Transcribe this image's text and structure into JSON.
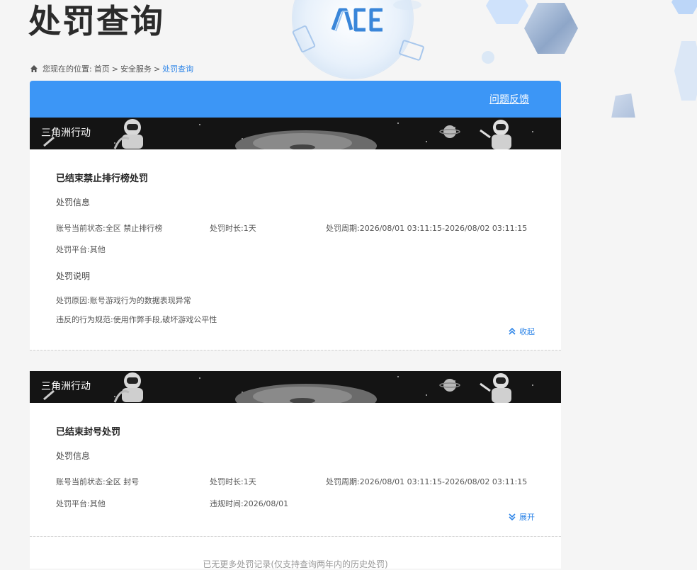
{
  "page": {
    "title": "处罚查询"
  },
  "breadcrumb": {
    "prefix": "您现在的位置:",
    "home": "首页",
    "sep1": ">",
    "security": "安全服务",
    "sep2": ">",
    "current": "处罚查询"
  },
  "header": {
    "feedback": "问题反馈"
  },
  "records": [
    {
      "game": "三角洲行动",
      "title": "已结束禁止排行榜处罚",
      "info_title": "处罚信息",
      "status_label": "账号当前状态:",
      "status_value": "全区 禁止排行榜",
      "duration_label": "处罚时长:",
      "duration_value": "1天",
      "period_label": "处罚周期:",
      "period_value": "2026/08/01 03:11:15-2026/08/02 03:11:15",
      "platform_label": "处罚平台:",
      "platform_value": "其他",
      "desc_title": "处罚说明",
      "reason_label": "处罚原因:",
      "reason_value": "账号游戏行为的数据表现异常",
      "rule_label": "违反的行为规范:",
      "rule_value": "使用作弊手段,破坏游戏公平性",
      "toggle": "收起"
    },
    {
      "game": "三角洲行动",
      "title": "已结束封号处罚",
      "info_title": "处罚信息",
      "status_label": "账号当前状态:",
      "status_value": "全区 封号",
      "duration_label": "处罚时长:",
      "duration_value": "1天",
      "period_label": "处罚周期:",
      "period_value": "2026/08/01 03:11:15-2026/08/02 03:11:15",
      "platform_label": "处罚平台:",
      "platform_value": "其他",
      "violation_time_label": "违规时间:",
      "violation_time_value": "2026/08/01",
      "toggle": "展开"
    }
  ],
  "footer": {
    "note": "已无更多处罚记录(仅支持查询两年内的历史处罚)"
  },
  "colors": {
    "accent": "#3c96f6",
    "link": "#2f86e8",
    "banner": "#141414"
  }
}
